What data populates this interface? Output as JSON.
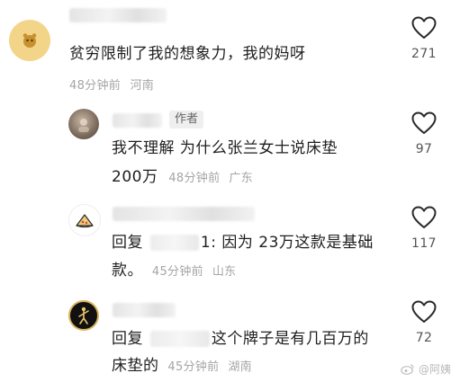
{
  "comments": [
    {
      "text": "贫穷限制了我的想象力，我的妈呀",
      "time": "48分钟前",
      "location": "河南",
      "likes": "271"
    },
    {
      "badge": "作者",
      "line1": "我不理解 为什么张兰女士说床垫",
      "line2": "200万",
      "time": "48分钟前",
      "location": "广东",
      "likes": "97"
    },
    {
      "reply_prefix": "回复",
      "mention_tail": "1",
      "line1_rest": ": 因为 23万这款是基础",
      "line2": "款。",
      "time": "45分钟前",
      "location": "山东",
      "likes": "117"
    },
    {
      "reply_prefix": "回复",
      "line1_rest": "这个牌子是有几百万的",
      "line2": "床垫的",
      "time": "45分钟前",
      "location": "湖南",
      "likes": "72"
    }
  ],
  "watermark": "@阿姨",
  "icons": {
    "like": "heart-outline-icon"
  }
}
